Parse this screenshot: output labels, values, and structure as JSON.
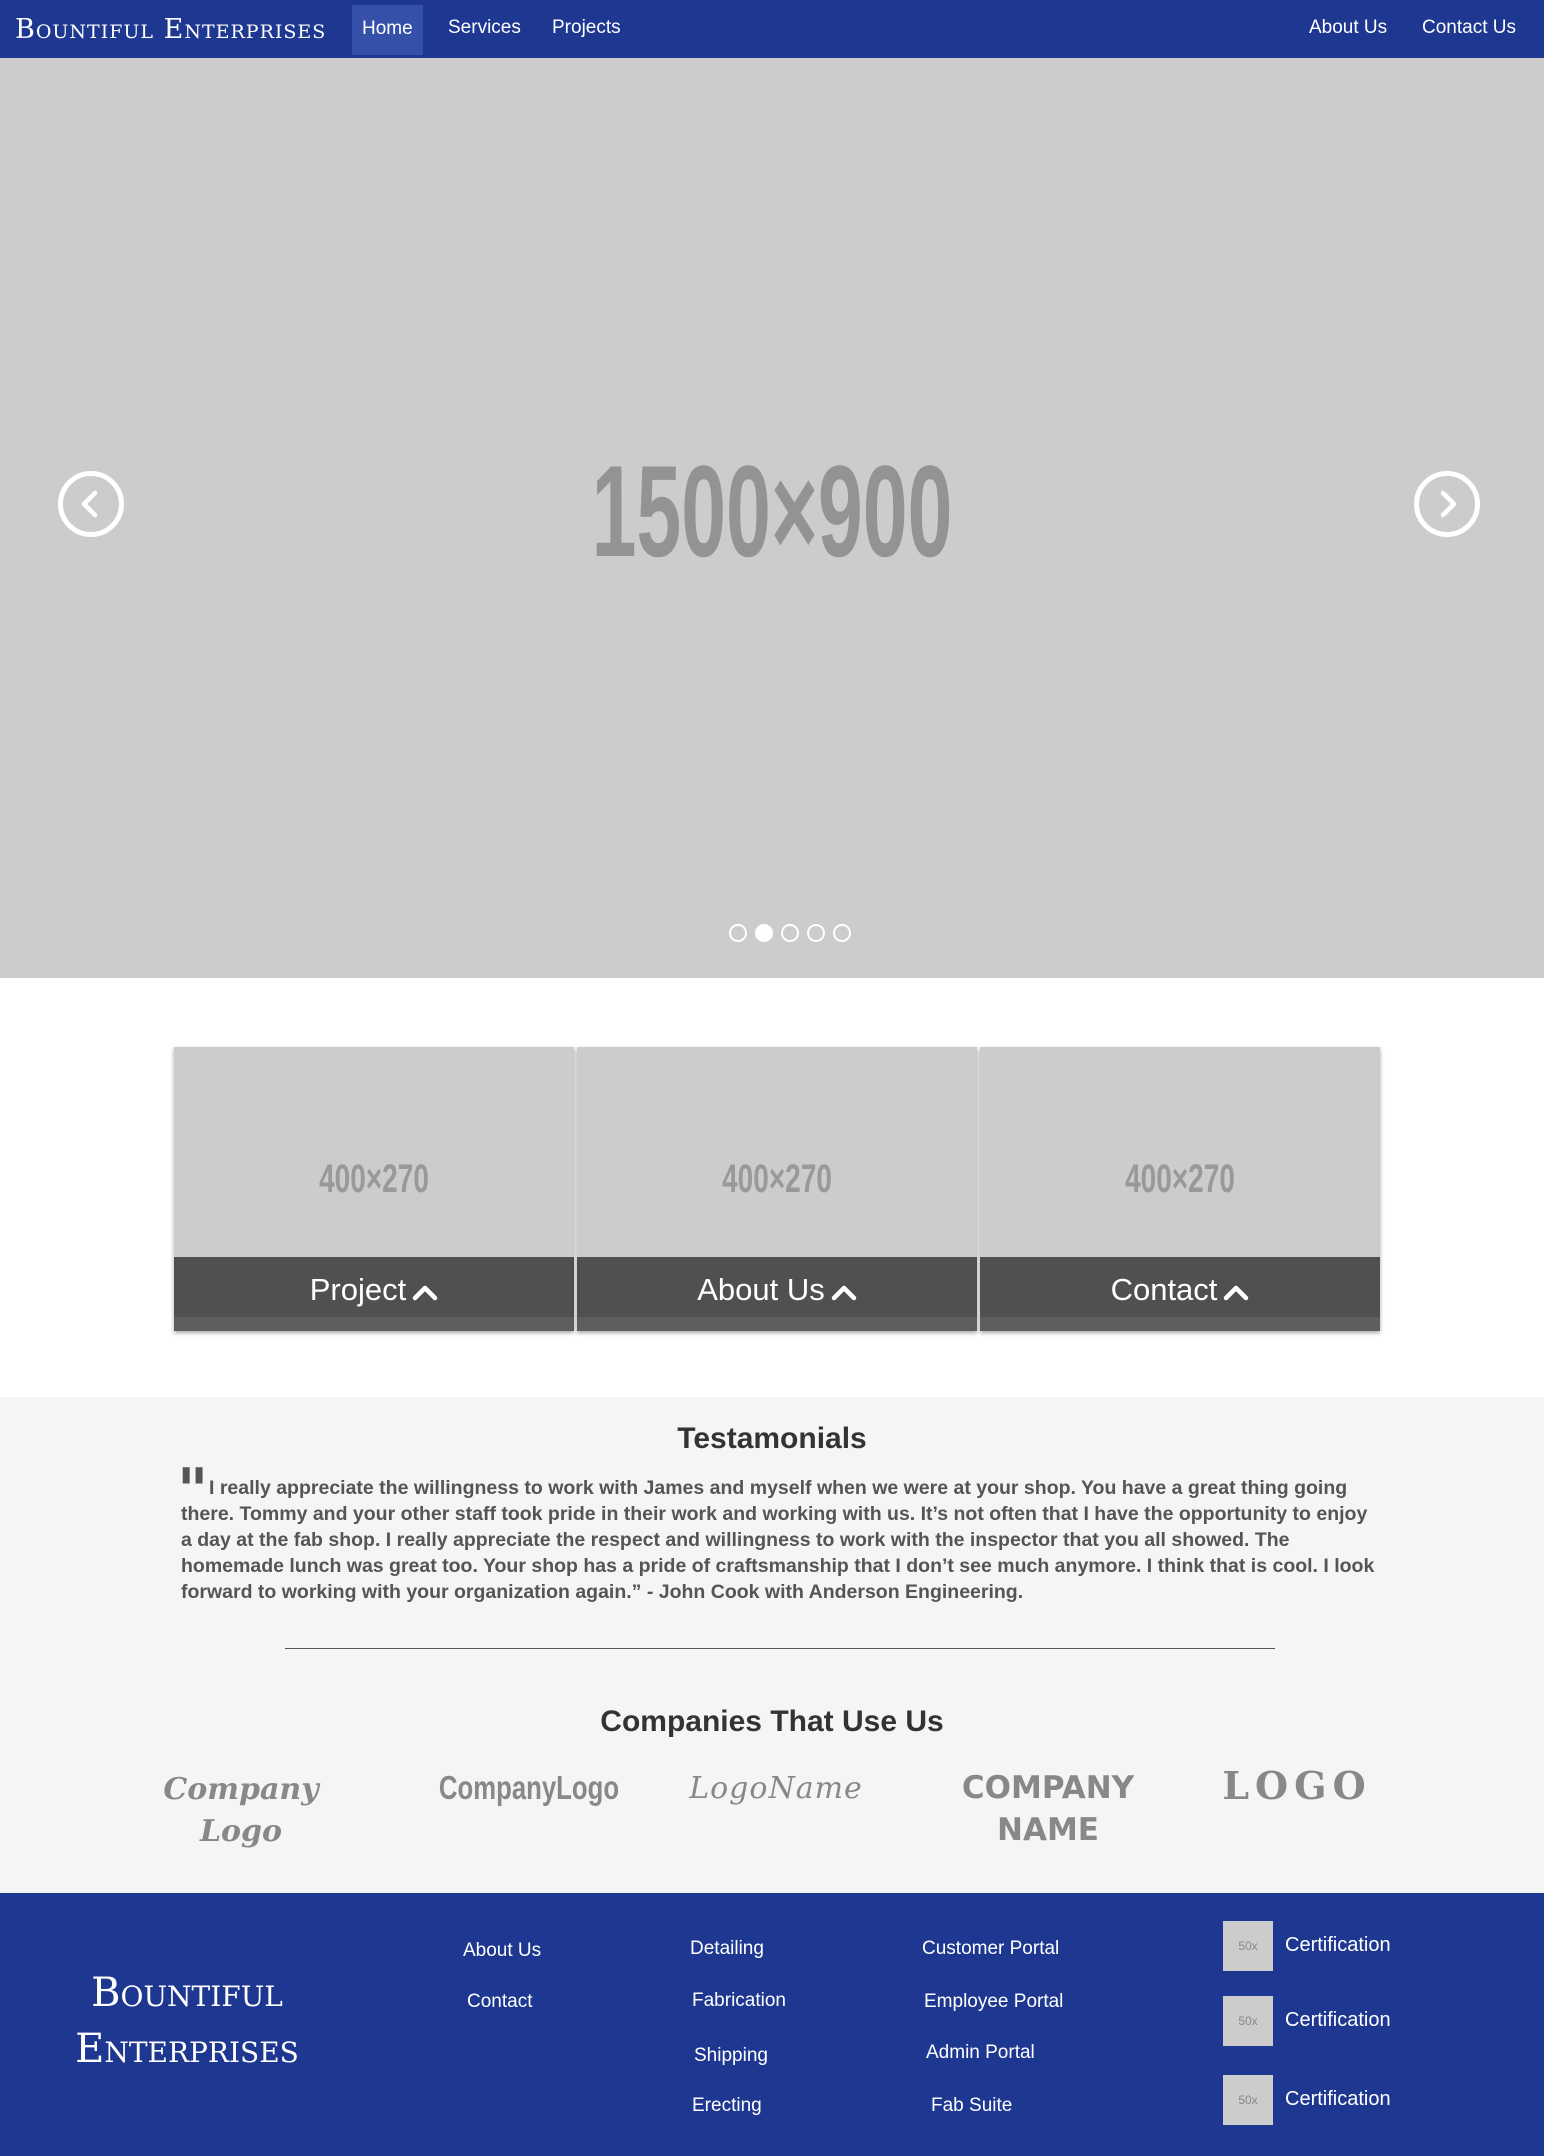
{
  "navbar": {
    "brand": "Bountiful Enterprises",
    "links": [
      {
        "label": "Home",
        "active": true
      },
      {
        "label": "Services"
      },
      {
        "label": "Projects"
      },
      {
        "label": "About Us"
      },
      {
        "label": "Contact Us"
      }
    ]
  },
  "hero": {
    "placeholder": "1500×900",
    "prev_icon": "chevron-left-icon",
    "next_icon": "chevron-right-icon",
    "indicators": {
      "count": 5,
      "active_index": 1
    }
  },
  "cards": [
    {
      "placeholder": "400×270",
      "label": "Project",
      "icon": "chevron-up-icon"
    },
    {
      "placeholder": "400×270",
      "label": "About Us",
      "icon": "chevron-up-icon"
    },
    {
      "placeholder": "400×270",
      "label": "Contact",
      "icon": "chevron-up-icon"
    }
  ],
  "testimonials": {
    "title": "Testamonials",
    "quote_mark": "\"",
    "text": "I really appreciate the willingness to work with James and myself when we were at your shop. You have a great thing going there. Tommy and your other staff took pride in their work and working with us. It’s not often that I have the opportunity to enjoy a day at the fab shop. I really appreciate the respect and willingness to work with the inspector that you all showed. The homemade lunch was great too. Your shop has a pride of craftsmanship that I don’t see much anymore. I think that is cool. I look forward to working with your organization again.” - John Cook with Anderson Engineering."
  },
  "companies": {
    "title": "Companies That Use Us",
    "logos": [
      "Company Logo",
      "CompanyLogo",
      "LogoName",
      "COMPANY NAME",
      "LOGO"
    ]
  },
  "footer": {
    "brand": "Bountiful Enterprises",
    "col1": [
      "About Us",
      "Contact"
    ],
    "col2": [
      "Detailing",
      "Fabrication",
      "Shipping",
      "Erecting"
    ],
    "col3": [
      "Customer Portal",
      "Employee Portal",
      "Admin Portal",
      "Fab Suite"
    ],
    "certifications": [
      {
        "thumb": "50x",
        "label": "Certification"
      },
      {
        "thumb": "50x",
        "label": "Certification"
      },
      {
        "thumb": "50x",
        "label": "Certification"
      }
    ]
  },
  "colors": {
    "brand_blue": "#1e3791",
    "placeholder_gray": "#cccccc",
    "card_bar": "#505050",
    "section_gray": "#f5f5f5"
  }
}
